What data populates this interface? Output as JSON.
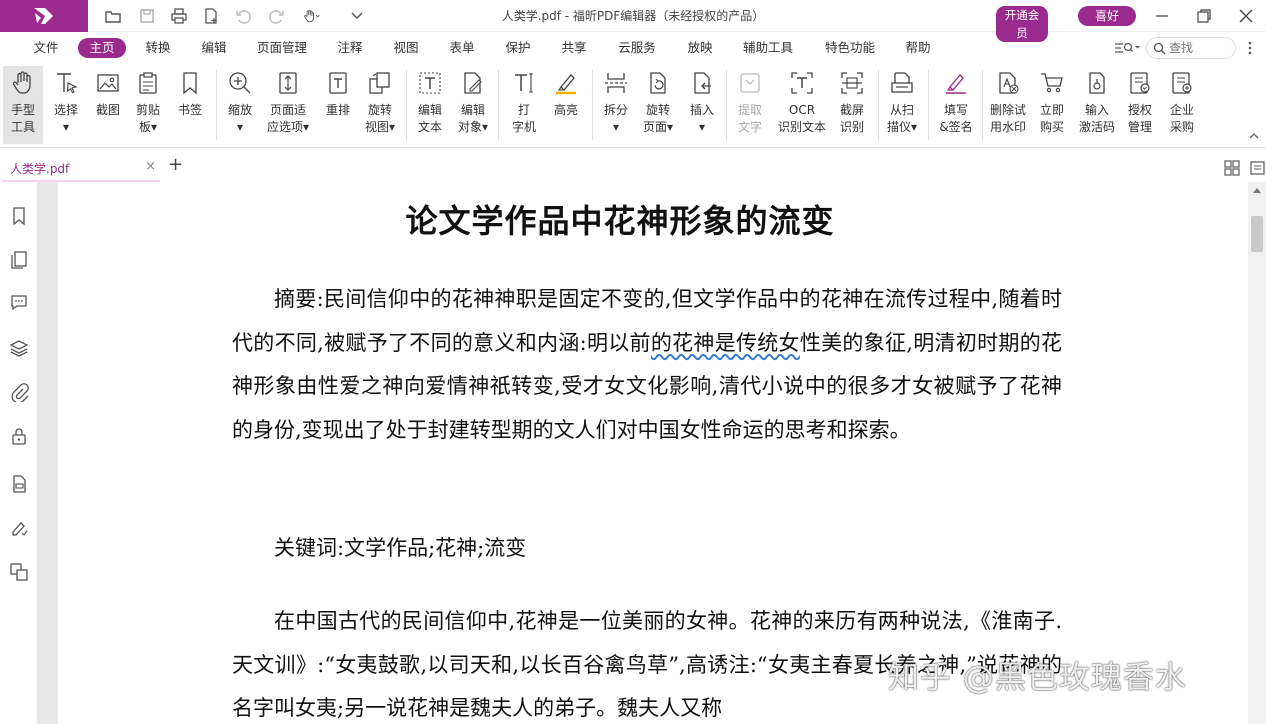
{
  "window": {
    "title": "人类学.pdf - 福昕PDF编辑器（未经授权的产品）",
    "vip_label": "开通会员",
    "favorite_label": "喜好"
  },
  "menu": {
    "items": [
      "文件",
      "主页",
      "转换",
      "编辑",
      "页面管理",
      "注释",
      "视图",
      "表单",
      "保护",
      "共享",
      "云服务",
      "放映",
      "辅助工具",
      "特色功能",
      "帮助"
    ],
    "active": "主页",
    "find_placeholder": "查找"
  },
  "ribbon": {
    "tools": [
      {
        "label": "手型\n工具",
        "icon": "hand-icon"
      },
      {
        "label": "选择\n▾",
        "icon": "select-icon"
      },
      {
        "label": "截图",
        "icon": "snapshot-icon"
      },
      {
        "label": "剪贴\n板▾",
        "icon": "clipboard-icon"
      },
      {
        "label": "书签",
        "icon": "bookmark-icon"
      },
      {
        "label": "缩放\n▾",
        "icon": "zoom-icon"
      },
      {
        "label": "页面适\n应选项▾",
        "icon": "fit-page-icon"
      },
      {
        "label": "重排",
        "icon": "reflow-icon"
      },
      {
        "label": "旋转\n视图▾",
        "icon": "rotate-view-icon"
      },
      {
        "label": "编辑\n文本",
        "icon": "edit-text-icon"
      },
      {
        "label": "编辑\n对象▾",
        "icon": "edit-object-icon"
      },
      {
        "label": "打\n字机",
        "icon": "typewriter-icon"
      },
      {
        "label": "高亮",
        "icon": "highlight-icon"
      },
      {
        "label": "拆分\n▾",
        "icon": "split-icon"
      },
      {
        "label": "旋转\n页面▾",
        "icon": "rotate-page-icon"
      },
      {
        "label": "插入\n▾",
        "icon": "insert-icon"
      },
      {
        "label": "提取\n文字",
        "icon": "extract-text-icon"
      },
      {
        "label": "OCR\n识别文本",
        "icon": "ocr-icon"
      },
      {
        "label": "截屏\n识别",
        "icon": "screenshot-ocr-icon"
      },
      {
        "label": "从扫\n描仪▾",
        "icon": "scanner-icon"
      },
      {
        "label": "填写\n&签名",
        "icon": "fill-sign-icon"
      },
      {
        "label": "删除试\n用水印",
        "icon": "remove-watermark-icon"
      },
      {
        "label": "立即\n购买",
        "icon": "cart-icon"
      },
      {
        "label": "输入\n激活码",
        "icon": "activation-code-icon"
      },
      {
        "label": "授权\n管理",
        "icon": "license-icon"
      },
      {
        "label": "企业\n采购",
        "icon": "enterprise-icon"
      }
    ]
  },
  "tabs": {
    "document": "人类学.pdf",
    "close": "×",
    "add": "+"
  },
  "sidebar": {
    "icons": [
      "bookmark-icon",
      "pages-icon",
      "comment-icon",
      "layers-icon",
      "attachment-icon",
      "security-icon",
      "form-icon",
      "signature-icon",
      "compare-icon"
    ]
  },
  "document": {
    "title": "论文学作品中花神形象的流变",
    "abstract_before": "摘要:民间信仰中的花神神职是固定不变的,但文学作品中的花神在流传过程中,随着时代的不同,被赋予了不同的意义和内涵:明以前",
    "abstract_underlined": "的花神是传统女",
    "abstract_after": "性美的象征,明清初时期的花神形象由性爱之神向爱情神祇转变,受才女文化影响,清代小说中的很多才女被赋予了花神的身份,变现出了处于封建转型期的文人们对中国女性命运的思考和探索。",
    "keywords": "关键词:文学作品;花神;流变",
    "body": "在中国古代的民间信仰中,花神是一位美丽的女神。花神的来历有两种说法,《淮南子.天文训》:“女夷鼓歌,以司天和,以长百谷禽鸟草”,高诱注:“女夷主春夏长养之神,”说花神的名字叫女夷;另一说花神是魏夫人的弟子。魏夫人又称"
  },
  "watermark": "知乎 @黑色玫瑰香水"
}
